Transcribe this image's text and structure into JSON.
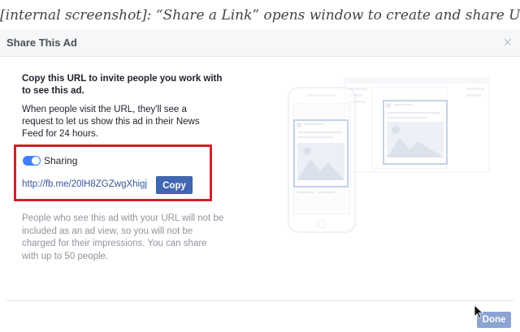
{
  "caption": "[internal screenshot]: “Share a Link” opens window to create and share URL",
  "dialog": {
    "title": "Share This Ad",
    "close_glyph": "×"
  },
  "body": {
    "instruction": "Copy this URL to invite people you work with to see this ad.",
    "explanation": "When people visit the URL, they'll see a request to let us show this ad in their News Feed for 24 hours.",
    "note": "People who see this ad with your URL will not be included as an ad view, so you will not be charged for their impressions. You can share with up to 50 people."
  },
  "sharing": {
    "toggle_label": "Sharing",
    "toggle_on": true,
    "url": "http://fb.me/20lH8ZGZwgXhigj",
    "copy_label": "Copy"
  },
  "footer": {
    "done_label": "Done"
  },
  "colors": {
    "accent": "#4267b2",
    "toggle_on": "#4080ff",
    "highlight": "#d0212b",
    "link": "#365899",
    "done_disabled": "#8ba4d3"
  },
  "icons": {
    "close": "close-icon",
    "cursor": "mouse-pointer-icon",
    "phone": "phone-mockup-icon",
    "desktop": "desktop-mockup-icon"
  }
}
